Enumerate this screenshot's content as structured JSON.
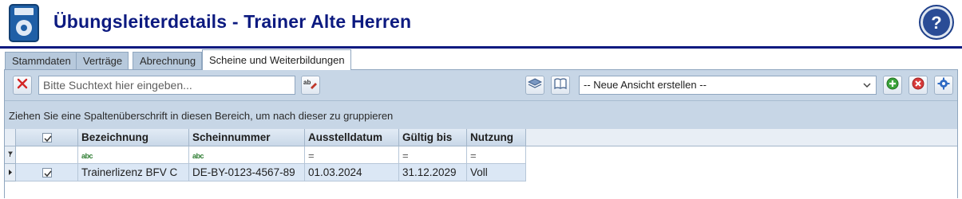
{
  "header": {
    "title": "Übungsleiterdetails - Trainer Alte Herren",
    "app_icon": "floppy-disk-icon",
    "help_icon": "help-question-icon"
  },
  "tabs": [
    {
      "label": "Stammdaten",
      "active": false
    },
    {
      "label": "Verträge",
      "active": false
    },
    {
      "label": "Abrechnung",
      "active": false
    },
    {
      "label": "Scheine und Weiterbildungen",
      "active": true
    }
  ],
  "toolbar": {
    "clear_icon": "close-x-icon",
    "search_placeholder": "Bitte Suchtext hier eingeben...",
    "spellcheck_icon": "abc-spellcheck-icon",
    "layers_icon": "layers-icon",
    "book_icon": "book-icon",
    "view_select_value": "-- Neue Ansicht erstellen --",
    "add_icon": "add-circle-icon",
    "delete_icon": "delete-circle-icon",
    "settings_icon": "gear-icon"
  },
  "group_hint": "Ziehen Sie eine Spaltenüberschrift in diesen Bereich, um nach dieser zu gruppieren",
  "grid": {
    "columns": [
      "Bezeichnung",
      "Scheinnummer",
      "Ausstelldatum",
      "Gültig bis",
      "Nutzung"
    ],
    "filter_row": {
      "bezeichnung": "abc",
      "scheinnummer": "abc",
      "ausstelldatum": "=",
      "gueltig_bis": "=",
      "nutzung": "="
    },
    "rows": [
      {
        "checked": true,
        "bezeichnung": "Trainerlizenz BFV C",
        "scheinnummer": "DE-BY-0123-4567-89",
        "ausstelldatum": "01.03.2024",
        "gueltig_bis": "31.12.2029",
        "nutzung": "Voll"
      }
    ]
  },
  "colors": {
    "title": "#0c1a80",
    "panel": "#c7d6e6",
    "tab": "#b7c9dc"
  }
}
